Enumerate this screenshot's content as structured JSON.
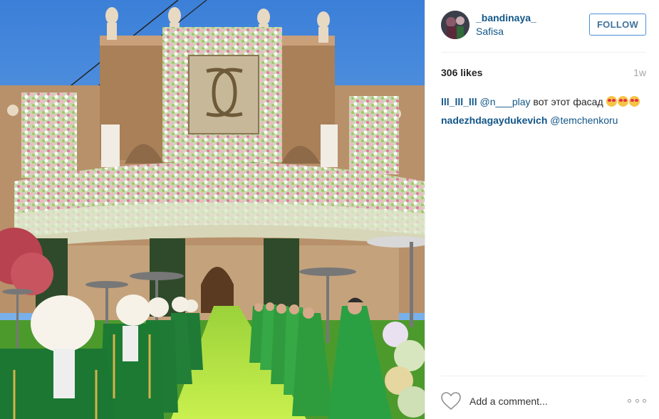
{
  "post": {
    "photo_icon": "photo",
    "colors": {
      "link": "#125688",
      "follow_border": "#4b90d9",
      "muted": "#a5a7aa"
    }
  },
  "header": {
    "username": "_bandinaya_",
    "location": "Safisa",
    "follow_label": "FOLLOW",
    "avatar_icon": "avatar"
  },
  "stats": {
    "likes": "306 likes",
    "time": "1w"
  },
  "comments": [
    {
      "user": "lll_lll_lll",
      "mention": "@n___play",
      "text": " вот этот фасад ",
      "emoji": [
        "heart-eyes-emoji",
        "heart-eyes-emoji",
        "heart-eyes-emoji"
      ]
    },
    {
      "user": "nadezhdagaydukevich",
      "mention": "@temchenkoru",
      "text": ""
    }
  ],
  "footer": {
    "like_icon": "heart-icon",
    "comment_placeholder": "Add a comment...",
    "more_icon": "more-options-icon"
  }
}
